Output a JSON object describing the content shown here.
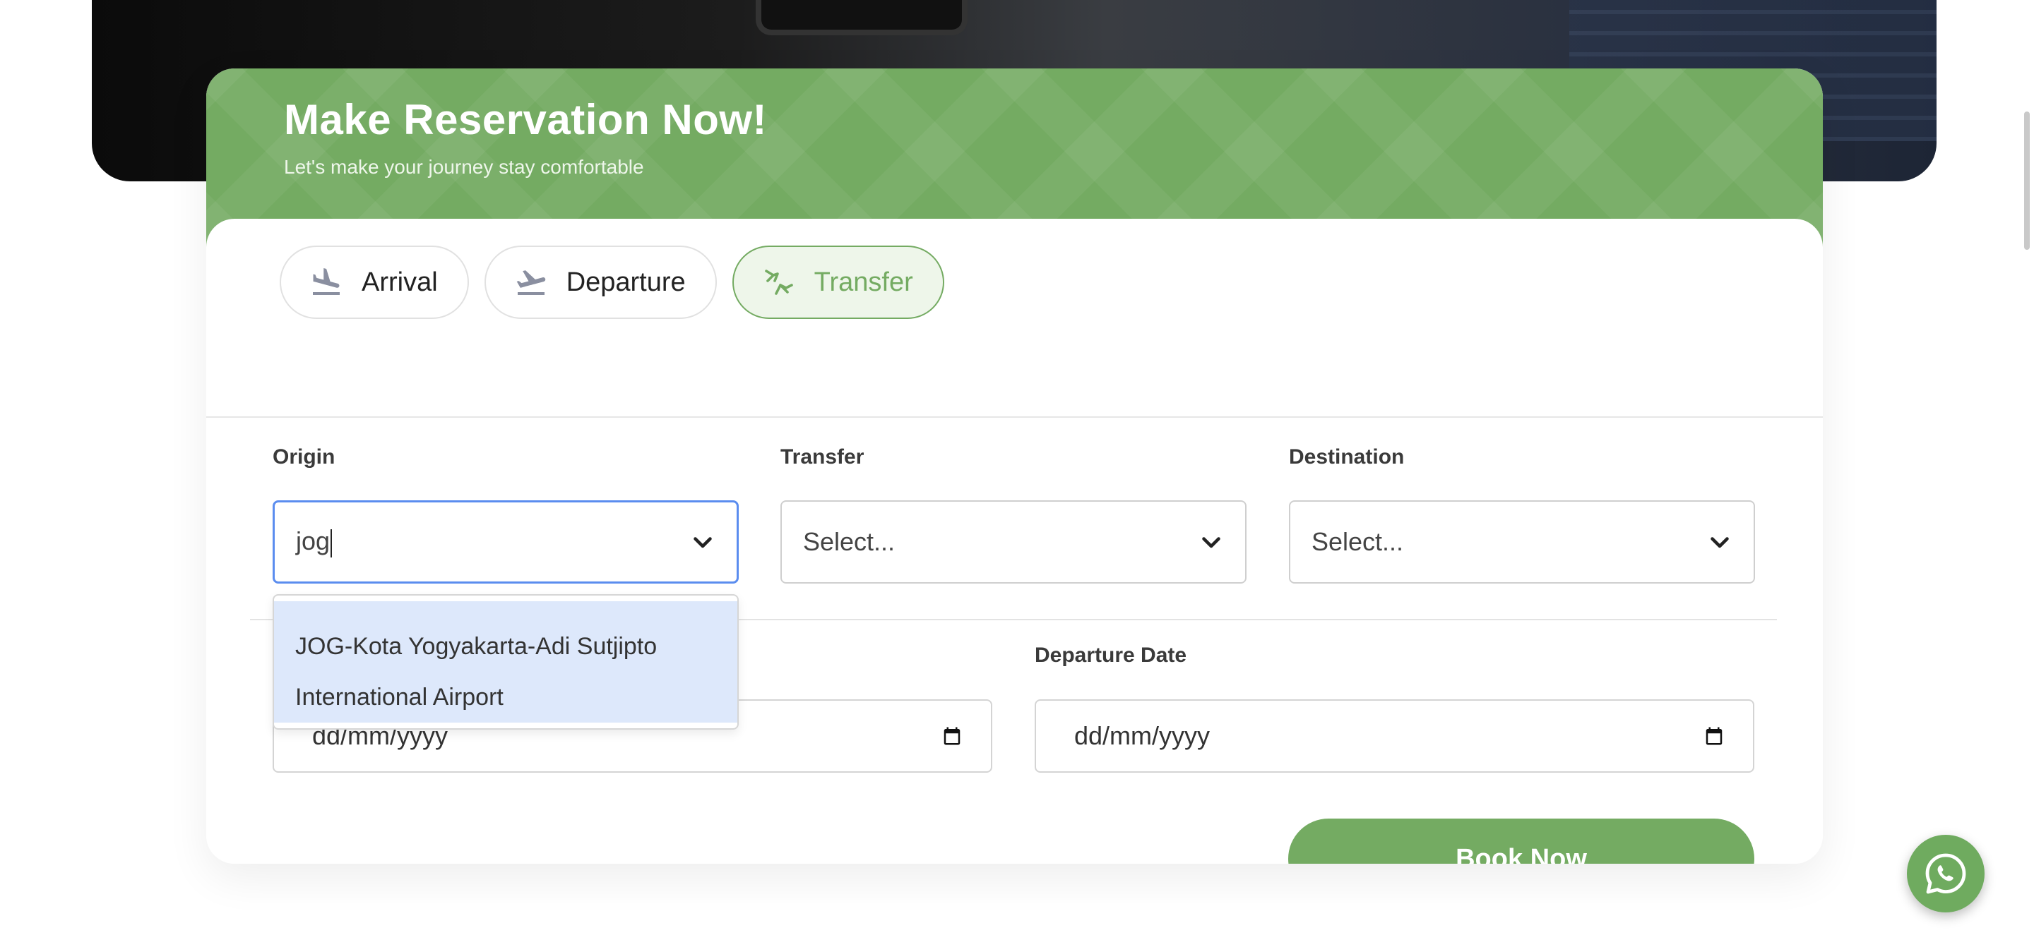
{
  "card": {
    "title": "Make Reservation Now!",
    "subtitle": "Let's make your journey stay comfortable"
  },
  "tabs": [
    {
      "label": "Arrival",
      "icon": "plane-landing-icon",
      "active": false
    },
    {
      "label": "Departure",
      "icon": "plane-takeoff-icon",
      "active": false
    },
    {
      "label": "Transfer",
      "icon": "plane-transfer-icon",
      "active": true
    }
  ],
  "fields": {
    "origin": {
      "label": "Origin",
      "value": "jog"
    },
    "transfer": {
      "label": "Transfer",
      "placeholder": "Select..."
    },
    "destination": {
      "label": "Destination",
      "placeholder": "Select..."
    },
    "arrival_date": {
      "placeholder": "dd/mm/yyyy"
    },
    "departure_date": {
      "label": "Departure Date",
      "placeholder": "dd/mm/yyyy"
    }
  },
  "dropdown": {
    "options": [
      {
        "line1": "JOG-Kota Yogyakarta-Adi Sutjipto",
        "line2": "International Airport"
      }
    ]
  },
  "book_button": {
    "label": "Book Now"
  },
  "colors": {
    "brand_green": "#74ab62",
    "focus_blue": "#5b8def",
    "option_highlight": "#dde8fb"
  }
}
